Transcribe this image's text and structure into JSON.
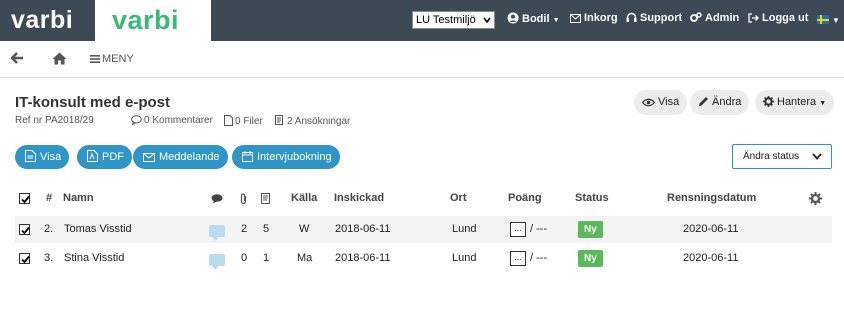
{
  "topbar": {
    "logo_text": "varbi",
    "env_select": "LU Testmiljö",
    "user": "Bodil",
    "inbox": "Inkorg",
    "support": "Support",
    "admin": "Admin",
    "logout": "Logga ut",
    "colors": {
      "bar": "#3d4a56",
      "brand_green": "#3cb878"
    }
  },
  "subbar": {
    "menu_label": "MENY"
  },
  "header": {
    "title": "IT-konsult med e-post",
    "ref": "Ref nr PA2018/29",
    "comments": "0 Kommentarer",
    "files": "0 Filer",
    "applications": "2 Ansökningar",
    "visa": "Visa",
    "andra": "Ändra",
    "hantera": "Hantera"
  },
  "actions": {
    "visa": "Visa",
    "pdf": "PDF",
    "meddelande": "Meddelande",
    "intervju": "Intervjubokning",
    "status_dropdown": "Ändra status",
    "accent": "#2f95c6"
  },
  "table": {
    "headers": {
      "num": "#",
      "name": "Namn",
      "kalla": "Källa",
      "inskickad": "Inskickad",
      "ort": "Ort",
      "poang": "Poäng",
      "status": "Status",
      "rensning": "Rensningsdatum"
    },
    "rows": [
      {
        "num": "2.",
        "name": "Tomas Visstid",
        "attachments": "2",
        "docs": "5",
        "kalla": "W",
        "inskickad": "2018-06-11",
        "ort": "Lund",
        "score_box": "...",
        "score_rest": "/ ---",
        "status": "Ny",
        "rensning": "2020-06-11",
        "checked": true
      },
      {
        "num": "3.",
        "name": "Stina Visstid",
        "attachments": "0",
        "docs": "1",
        "kalla": "Ma",
        "inskickad": "2018-06-11",
        "ort": "Lund",
        "score_box": "...",
        "score_rest": "/ ---",
        "status": "Ny",
        "rensning": "2020-06-11",
        "checked": true
      }
    ],
    "status_color": "#5cb85c"
  }
}
